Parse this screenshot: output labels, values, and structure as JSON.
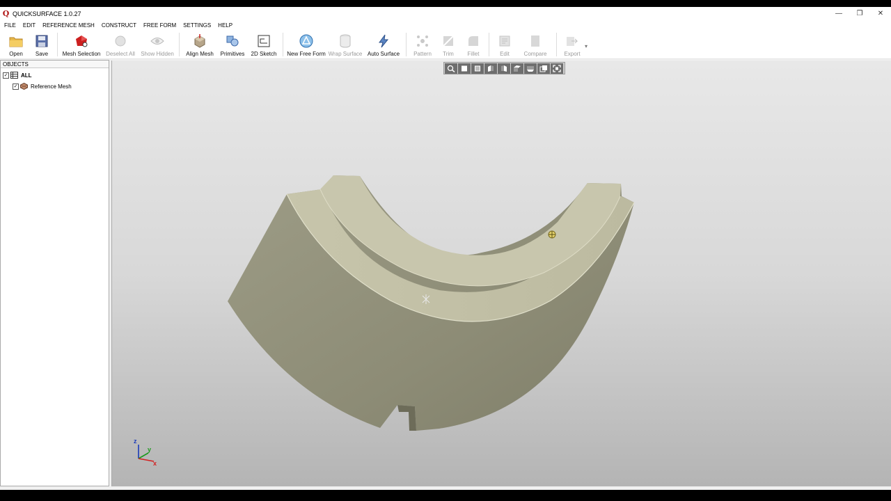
{
  "window": {
    "title": "QUICKSURFACE 1.0.27",
    "logo_text": "Q",
    "controls": {
      "minimize": "—",
      "restore": "❐",
      "close": "✕"
    }
  },
  "menu": [
    "FILE",
    "EDIT",
    "REFERENCE MESH",
    "CONSTRUCT",
    "FREE FORM",
    "SETTINGS",
    "HELP"
  ],
  "toolbar": {
    "open": "Open",
    "save": "Save",
    "mesh_selection": "Mesh Selection",
    "deselect_all": "Deselect All",
    "show_hidden": "Show Hidden",
    "align_mesh": "Align Mesh",
    "primitives": "Primitives",
    "sketch_2d": "2D Sketch",
    "new_free_form": "New Free Form",
    "wrap_surface": "Wrap Surface",
    "auto_surface": "Auto Surface",
    "pattern": "Pattern",
    "trim": "Trim",
    "fillet": "Fillet",
    "edit": "Edit",
    "compare": "Compare",
    "export": "Export",
    "more": "▾"
  },
  "objects": {
    "header": "OBJECTS",
    "items": [
      {
        "label": "ALL",
        "checked": true
      },
      {
        "label": "Reference Mesh",
        "checked": true
      }
    ]
  },
  "axes": {
    "z": "z",
    "y": "y",
    "x": "x"
  },
  "colors": {
    "mesh_side": "#9a9a85",
    "mesh_top": "#c4c2a8",
    "accent_red": "#cc1f1f",
    "axis_x": "#d32020",
    "axis_y": "#1b9a1b",
    "axis_z": "#1a3ab8"
  }
}
